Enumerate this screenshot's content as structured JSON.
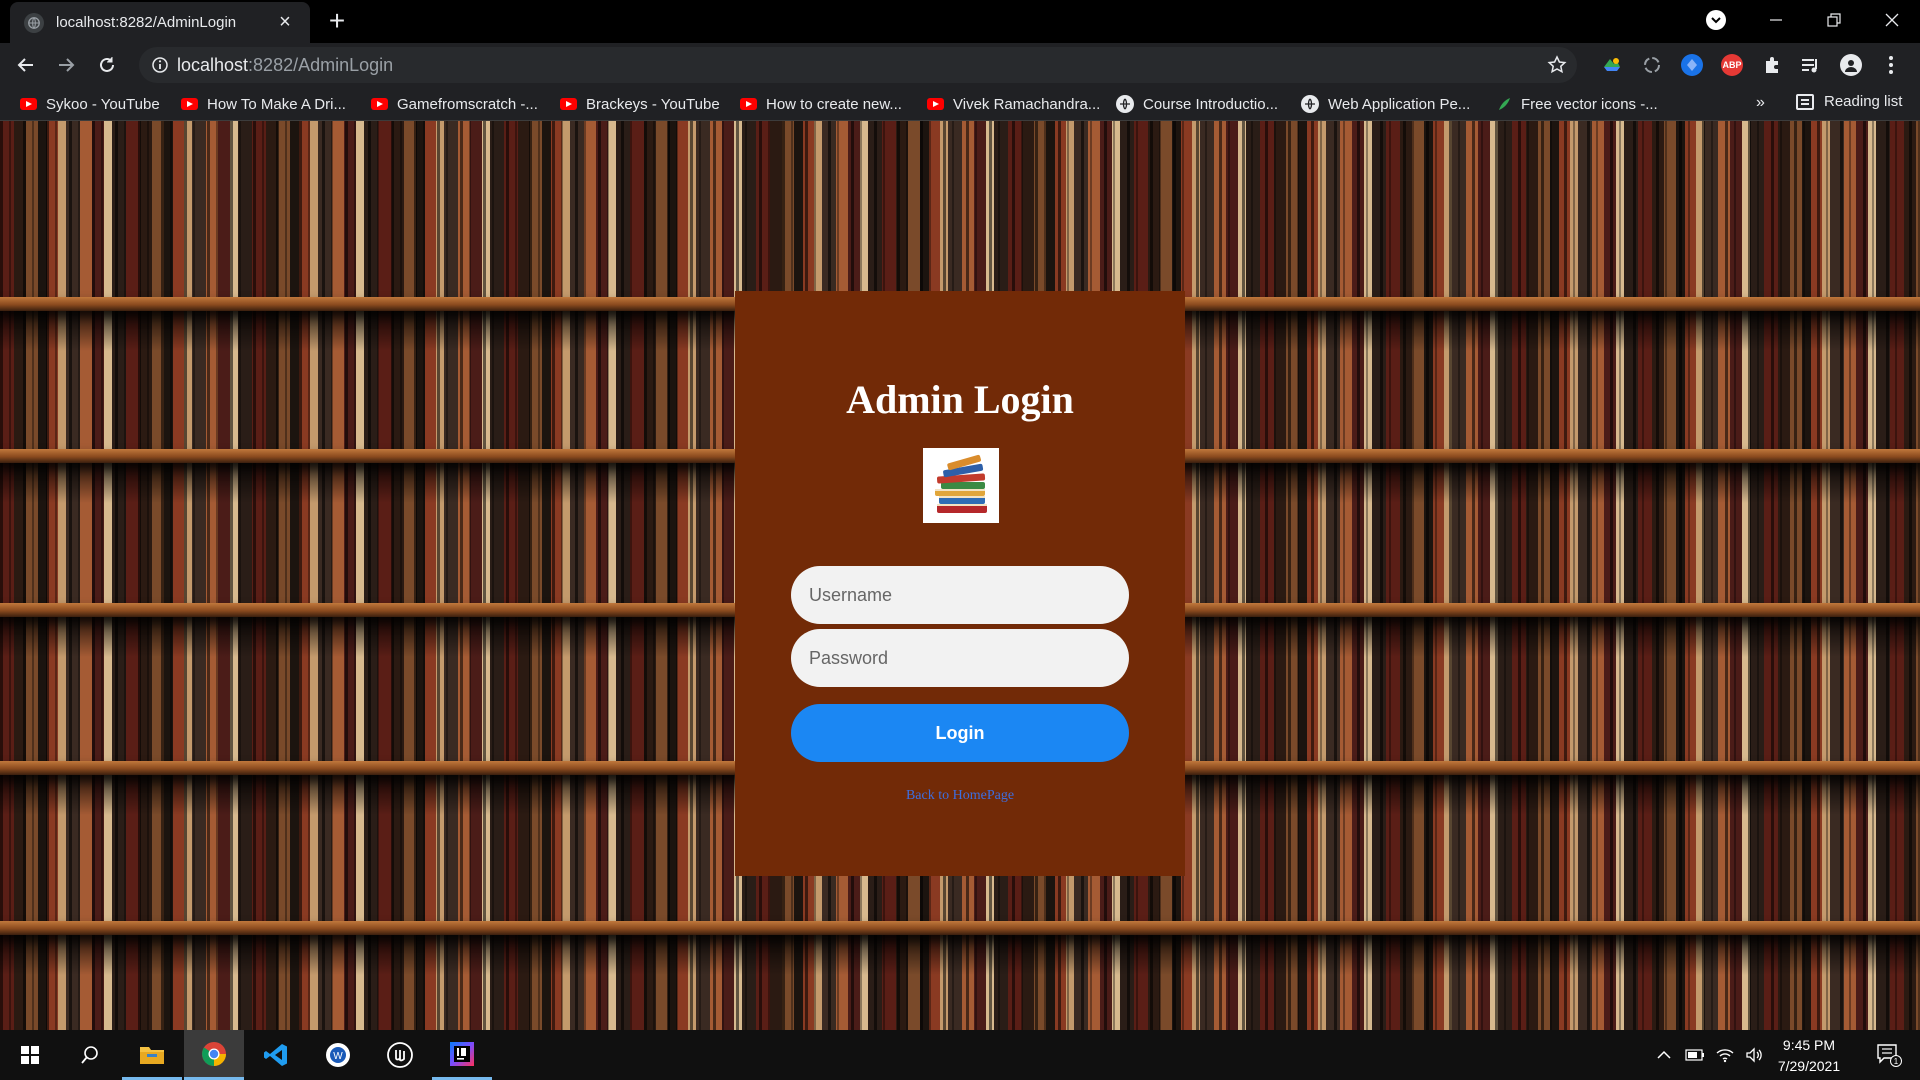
{
  "browser": {
    "tab_title": "localhost:8282/AdminLogin",
    "url_host": "localhost",
    "url_rest": ":8282/AdminLogin",
    "bookmarks": [
      {
        "label": "Sykoo - YouTube",
        "icon": "youtube-icon"
      },
      {
        "label": "How To Make A Dri...",
        "icon": "youtube-icon"
      },
      {
        "label": "Gamefromscratch -...",
        "icon": "youtube-icon"
      },
      {
        "label": "Brackeys - YouTube",
        "icon": "youtube-icon"
      },
      {
        "label": "How to create new...",
        "icon": "youtube-icon"
      },
      {
        "label": "Vivek Ramachandra...",
        "icon": "youtube-icon"
      },
      {
        "label": "Course Introductio...",
        "icon": "globe-icon"
      },
      {
        "label": "Web Application Pe...",
        "icon": "globe-icon"
      },
      {
        "label": "Free vector icons -...",
        "icon": "leaf-icon"
      }
    ],
    "bookmarks_overflow": "»",
    "reading_list": "Reading list",
    "abp_label": "ABP"
  },
  "login": {
    "title": "Admin Login",
    "username_placeholder": "Username",
    "password_placeholder": "Password",
    "login_button": "Login",
    "back_link": "Back to HomePage"
  },
  "taskbar": {
    "time": "9:45 PM",
    "date": "7/29/2021",
    "notification_count": "1"
  },
  "colors": {
    "card_bg": "#722a07",
    "login_button": "#1b87f3",
    "link": "#3d6ee0"
  }
}
